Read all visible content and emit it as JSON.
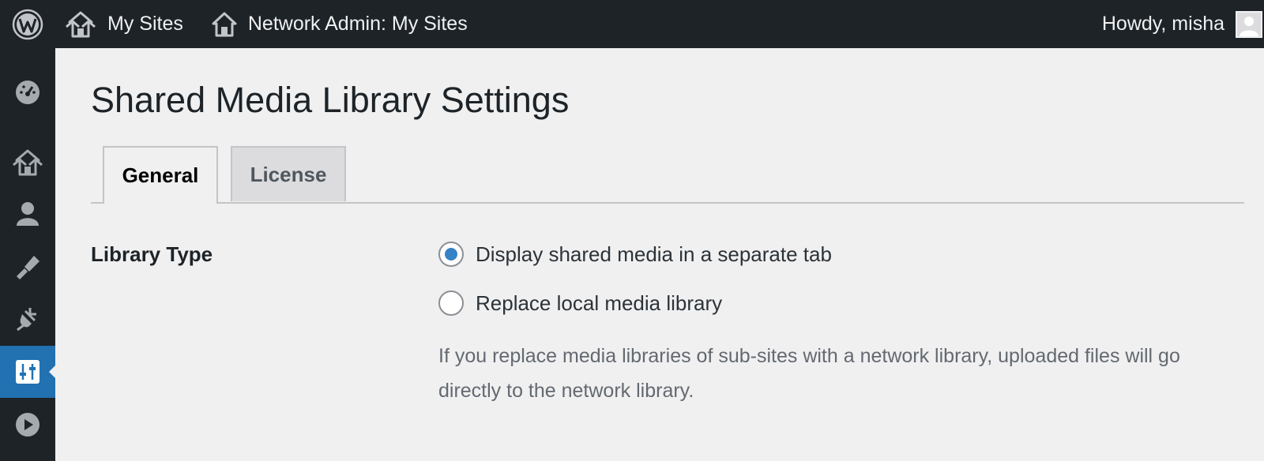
{
  "adminbar": {
    "logo_icon": "wordpress-logo-icon",
    "my_sites": {
      "icon": "my-sites-icon",
      "label": "My Sites"
    },
    "network_admin": {
      "icon": "home-icon",
      "label": "Network Admin: My Sites"
    },
    "howdy": "Howdy, misha",
    "avatar_icon": "avatar-icon"
  },
  "sidemenu": {
    "items": [
      {
        "name": "dashboard",
        "icon": "dashboard-icon"
      },
      {
        "name": "sites",
        "icon": "my-sites-icon"
      },
      {
        "name": "users",
        "icon": "users-icon"
      },
      {
        "name": "themes",
        "icon": "appearance-brush-icon"
      },
      {
        "name": "plugins",
        "icon": "plugins-icon"
      },
      {
        "name": "settings",
        "icon": "settings-sliders-icon",
        "active": true
      },
      {
        "name": "media-player",
        "icon": "play-circle-icon"
      }
    ]
  },
  "page": {
    "title": "Shared Media Library Settings",
    "tabs": [
      {
        "label": "General",
        "active": true
      },
      {
        "label": "License",
        "active": false
      }
    ],
    "setting": {
      "label": "Library Type",
      "options": [
        {
          "label": "Display shared media in a separate tab",
          "checked": true
        },
        {
          "label": "Replace local media library",
          "checked": false
        }
      ],
      "description": "If you replace media libraries of sub-sites with a network library, uploaded files will go directly to the network library."
    }
  },
  "colors": {
    "adminbar_bg": "#1d2327",
    "accent": "#2271b1",
    "page_bg": "#f0f0f1",
    "radio_checked": "#3582c4"
  }
}
